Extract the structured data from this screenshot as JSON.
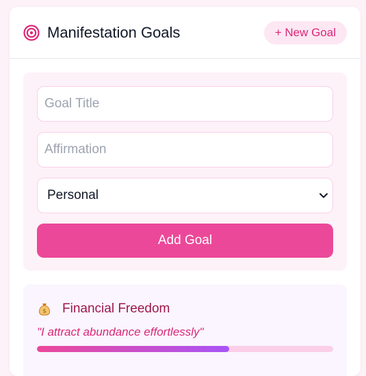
{
  "header": {
    "title": "Manifestation Goals",
    "new_goal_label": "+ New Goal"
  },
  "form": {
    "goal_title_placeholder": "Goal Title",
    "affirmation_placeholder": "Affirmation",
    "category_selected": "Personal",
    "add_button_label": "Add Goal"
  },
  "goals": [
    {
      "icon": "money-bag-icon",
      "title": "Financial Freedom",
      "affirmation": "\"I attract abundance effortlessly\"",
      "progress": 0.65
    }
  ],
  "colors": {
    "accent": "#ec4899",
    "accent_soft": "#fce7f3",
    "progress_start": "#ec4899",
    "progress_end": "#a855f7"
  }
}
